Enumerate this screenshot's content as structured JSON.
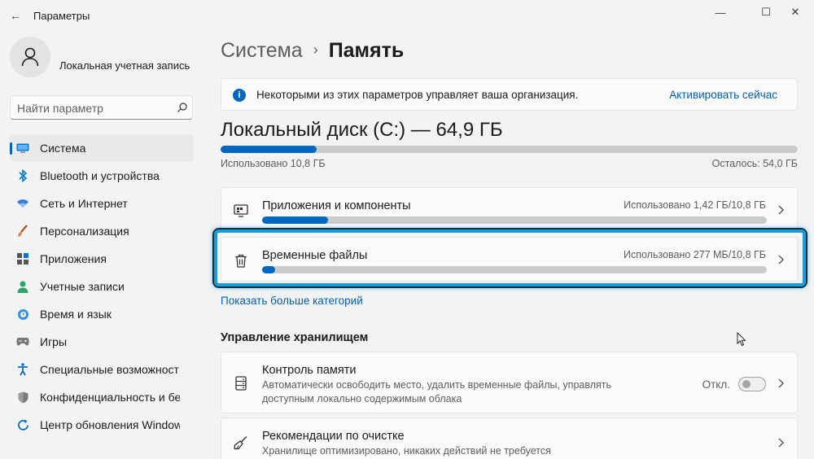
{
  "window": {
    "title": "Параметры",
    "back_glyph": "←",
    "minimize_glyph": "—",
    "maximize_glyph": "☐",
    "close_glyph": "✕"
  },
  "account": {
    "name": "Локальная учетная запись"
  },
  "search": {
    "placeholder": "Найти параметр"
  },
  "sidebar": {
    "items": [
      {
        "label": "Система",
        "icon": "system-icon",
        "active": true
      },
      {
        "label": "Bluetooth и устройства",
        "icon": "bluetooth-icon"
      },
      {
        "label": "Сеть и Интернет",
        "icon": "wifi-icon"
      },
      {
        "label": "Персонализация",
        "icon": "brush-icon"
      },
      {
        "label": "Приложения",
        "icon": "apps-icon"
      },
      {
        "label": "Учетные записи",
        "icon": "accounts-icon"
      },
      {
        "label": "Время и язык",
        "icon": "globe-clock-icon"
      },
      {
        "label": "Игры",
        "icon": "gamepad-icon"
      },
      {
        "label": "Специальные возможност",
        "icon": "accessibility-icon"
      },
      {
        "label": "Конфиденциальность и бе",
        "icon": "shield-icon"
      },
      {
        "label": "Центр обновления Window",
        "icon": "update-icon"
      }
    ]
  },
  "breadcrumb": {
    "parent": "Система",
    "separator": "›",
    "current": "Память"
  },
  "infobar": {
    "text": "Некоторыми из этих параметров управляет ваша организация.",
    "link": "Активировать сейчас"
  },
  "disk": {
    "title": "Локальный диск (C:) — 64,9 ГБ",
    "used_label": "Использовано 10,8 ГБ",
    "free_label": "Осталось: 54,0 ГБ",
    "used_fraction": 0.166
  },
  "categories": [
    {
      "title": "Приложения и компоненты",
      "meta": "Использовано 1,42 ГБ/10,8 ГБ",
      "fraction": 0.13,
      "icon": "apps-features-icon"
    },
    {
      "title": "Временные файлы",
      "meta": "Использовано 277 МБ/10,8 ГБ",
      "fraction": 0.025,
      "icon": "trash-icon"
    }
  ],
  "more_link": "Показать больше категорий",
  "storage_management": {
    "heading": "Управление хранилищем",
    "storage_sense": {
      "title": "Контроль памяти",
      "description": "Автоматически освободить место, удалить временные файлы, управлять доступным локально содержимым облака",
      "toggle_label": "Откл.",
      "enabled": false
    },
    "cleanup": {
      "title": "Рекомендации по очистке",
      "description": "Хранилище оптимизировано, никаких действий не требуется"
    }
  },
  "colors": {
    "accent": "#0067c0",
    "link": "#005fb8",
    "highlight": "#1e9bd7"
  }
}
